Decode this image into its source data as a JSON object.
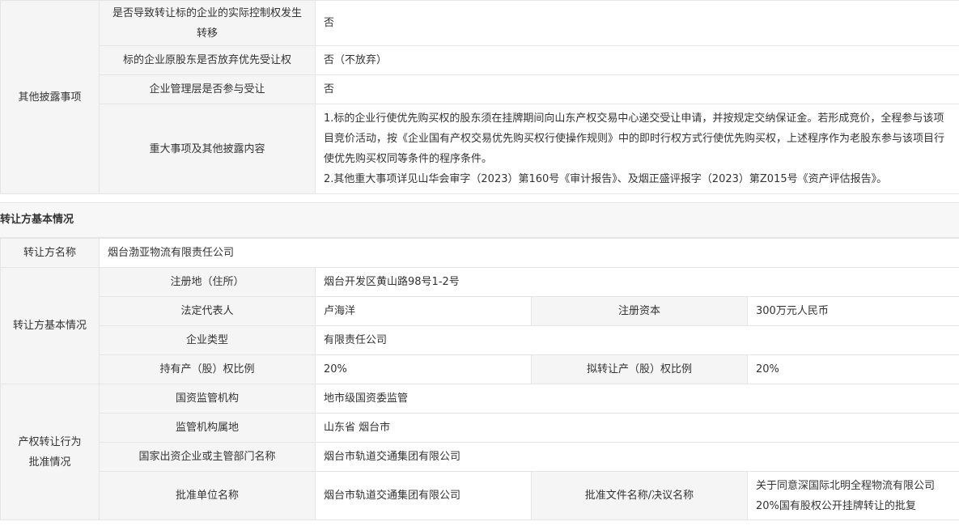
{
  "disclosure": {
    "group_label": "其他披露事项",
    "rows": [
      {
        "label": "是否导致转让标的企业的实际控制权发生转移",
        "value": "否"
      },
      {
        "label": "标的企业原股东是否放弃优先受让权",
        "value": "否（不放弃）"
      },
      {
        "label": "企业管理层是否参与受让",
        "value": "否"
      },
      {
        "label": "重大事项及其他披露内容",
        "value_line1": "1.标的企业行使优先购买权的股东须在挂牌期间向山东产权交易中心递交受让申请，并按规定交纳保证金。若形成竞价，全程参与该项目竞价活动，按《企业国有产权交易优先购买权行使操作规则》中的即时行权方式行使优先购买权，上述程序作为老股东参与该项目行使优先购买权同等条件的程序条件。",
        "value_line2": "2.其他重大事项详见山华会审字（2023）第160号《审计报告》、及烟正盛评报字（2023）第Z015号《资产评估报告》。"
      }
    ]
  },
  "transferor_section_title": "转让方基本情况",
  "transferor": {
    "name_label": "转让方名称",
    "name_value": "烟台渤亚物流有限责任公司",
    "group_label": "转让方基本情况",
    "address_label": "注册地（住所）",
    "address_value": "烟台开发区黄山路98号1-2号",
    "legal_rep_label": "法定代表人",
    "legal_rep_value": "卢海洋",
    "reg_capital_label": "注册资本",
    "reg_capital_value": "300万元人民币",
    "company_type_label": "企业类型",
    "company_type_value": "有限责任公司",
    "holding_ratio_label": "持有产（股）权比例",
    "holding_ratio_value": "20%",
    "transfer_ratio_label": "拟转让产（股）权比例",
    "transfer_ratio_value": "20%"
  },
  "approval": {
    "group_label_line1": "产权转让行为",
    "group_label_line2": "批准情况",
    "regulator_label": "国资监管机构",
    "regulator_value": "地市级国资委监管",
    "location_label": "监管机构属地",
    "location_value": "山东省 烟台市",
    "investor_label": "国家出资企业或主管部门名称",
    "investor_value": "烟台市轨道交通集团有限公司",
    "approver_label": "批准单位名称",
    "approver_value": "烟台市轨道交通集团有限公司",
    "doc_label": "批准文件名称/决议名称",
    "doc_value_line1": "关于同意深国际北明全程物流有限公司",
    "doc_value_line2": "20%国有股权公开挂牌转让的批复"
  }
}
